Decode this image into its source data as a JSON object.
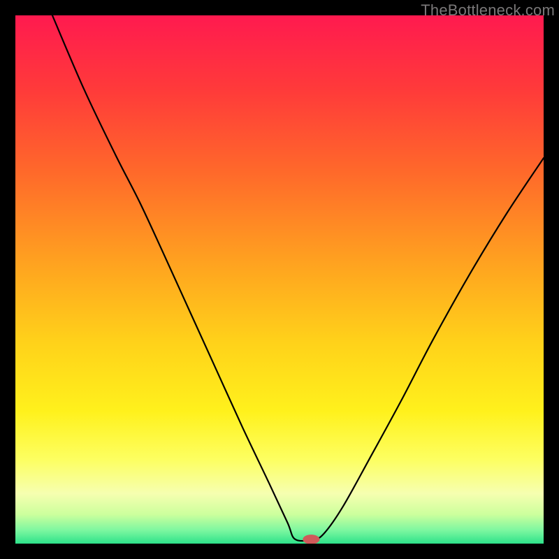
{
  "watermark": "TheBottleneck.com",
  "chart_data": {
    "type": "line",
    "title": "",
    "xlabel": "",
    "ylabel": "",
    "xlim": [
      0,
      100
    ],
    "ylim": [
      0,
      100
    ],
    "gradient_stops": [
      {
        "offset": 0.0,
        "color": "#ff1a4f"
      },
      {
        "offset": 0.14,
        "color": "#ff3a3a"
      },
      {
        "offset": 0.3,
        "color": "#ff6a2a"
      },
      {
        "offset": 0.48,
        "color": "#ffa61f"
      },
      {
        "offset": 0.62,
        "color": "#ffd21a"
      },
      {
        "offset": 0.75,
        "color": "#fff11c"
      },
      {
        "offset": 0.84,
        "color": "#fdff60"
      },
      {
        "offset": 0.905,
        "color": "#f6ffb0"
      },
      {
        "offset": 0.945,
        "color": "#ccff9d"
      },
      {
        "offset": 0.975,
        "color": "#7cf7a0"
      },
      {
        "offset": 1.0,
        "color": "#2de28a"
      }
    ],
    "series": [
      {
        "name": "bottleneck-curve",
        "points": [
          {
            "x": 7.0,
            "y": 100.0
          },
          {
            "x": 13.0,
            "y": 86.0
          },
          {
            "x": 19.0,
            "y": 73.5
          },
          {
            "x": 23.5,
            "y": 64.7
          },
          {
            "x": 28.0,
            "y": 55.0
          },
          {
            "x": 33.0,
            "y": 44.0
          },
          {
            "x": 38.0,
            "y": 33.0
          },
          {
            "x": 43.0,
            "y": 22.0
          },
          {
            "x": 48.0,
            "y": 11.5
          },
          {
            "x": 51.5,
            "y": 4.0
          },
          {
            "x": 53.0,
            "y": 0.8
          },
          {
            "x": 56.5,
            "y": 0.8
          },
          {
            "x": 58.5,
            "y": 2.0
          },
          {
            "x": 62.0,
            "y": 7.0
          },
          {
            "x": 67.0,
            "y": 16.0
          },
          {
            "x": 73.0,
            "y": 27.0
          },
          {
            "x": 79.0,
            "y": 38.5
          },
          {
            "x": 86.0,
            "y": 51.0
          },
          {
            "x": 93.0,
            "y": 62.5
          },
          {
            "x": 100.0,
            "y": 73.0
          }
        ]
      }
    ],
    "marker": {
      "x": 56.0,
      "y": 0.8,
      "rx": 1.6,
      "ry": 0.9,
      "color": "#d05a5a"
    }
  }
}
